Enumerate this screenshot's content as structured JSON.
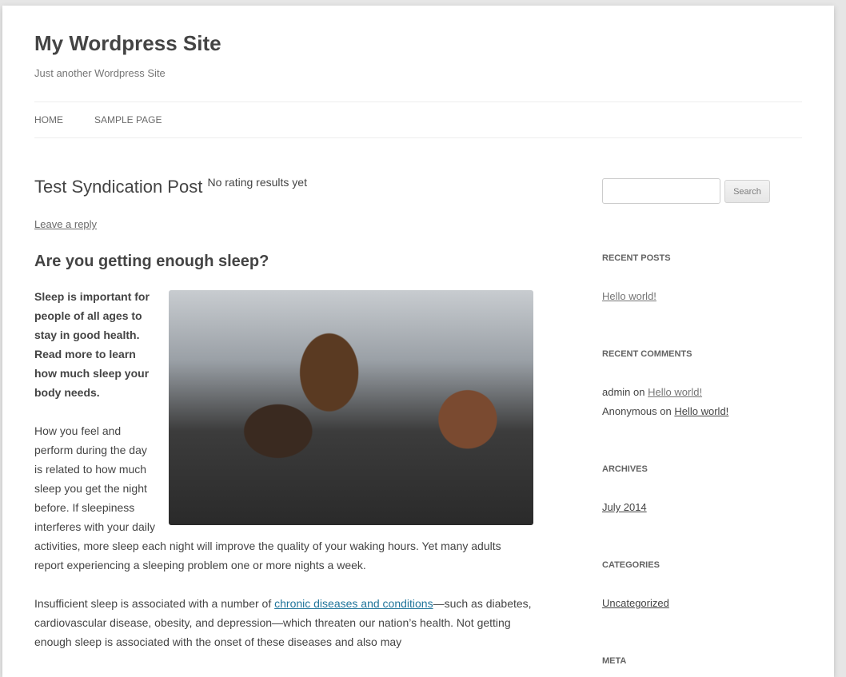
{
  "site": {
    "title": "My Wordpress Site",
    "tagline": "Just another Wordpress Site"
  },
  "nav": [
    {
      "label": "HOME"
    },
    {
      "label": "SAMPLE PAGE"
    }
  ],
  "post": {
    "title": "Test Syndication Post",
    "rating": "No rating results yet",
    "reply": "Leave a reply",
    "heading": "Are you getting enough sleep?",
    "intro": "Sleep is important for people of all ages to stay in good health. Read more to learn how much sleep your body needs.",
    "para1": "How you feel and perform during the day is related to how much sleep you get the night before. If sleepiness interferes with your daily activities, more sleep each night will improve the quality of your waking hours. Yet many adults report experiencing a sleeping problem one or more nights a week.",
    "para2_pre": "Insufficient sleep is associated with a number of ",
    "para2_link": "chronic diseases and conditions",
    "para2_post": "—such as diabetes, cardiovascular disease, obesity, and depression—which threaten our nation’s health. Not getting enough sleep is associated with the onset of these diseases and also may",
    "image_alt": "Three young people asleep in the back seat of a car"
  },
  "sidebar": {
    "search_button": "Search",
    "search_value": "",
    "recent_posts": {
      "title": "RECENT POSTS",
      "items": [
        "Hello world!"
      ]
    },
    "recent_comments": {
      "title": "RECENT COMMENTS",
      "items": [
        {
          "author": "admin",
          "on": "on",
          "post": "Hello world!"
        },
        {
          "author": "Anonymous",
          "on": "on",
          "post": "Hello world!"
        }
      ]
    },
    "archives": {
      "title": "ARCHIVES",
      "items": [
        "July 2014"
      ]
    },
    "categories": {
      "title": "CATEGORIES",
      "items": [
        "Uncategorized"
      ]
    },
    "meta": {
      "title": "META"
    }
  }
}
